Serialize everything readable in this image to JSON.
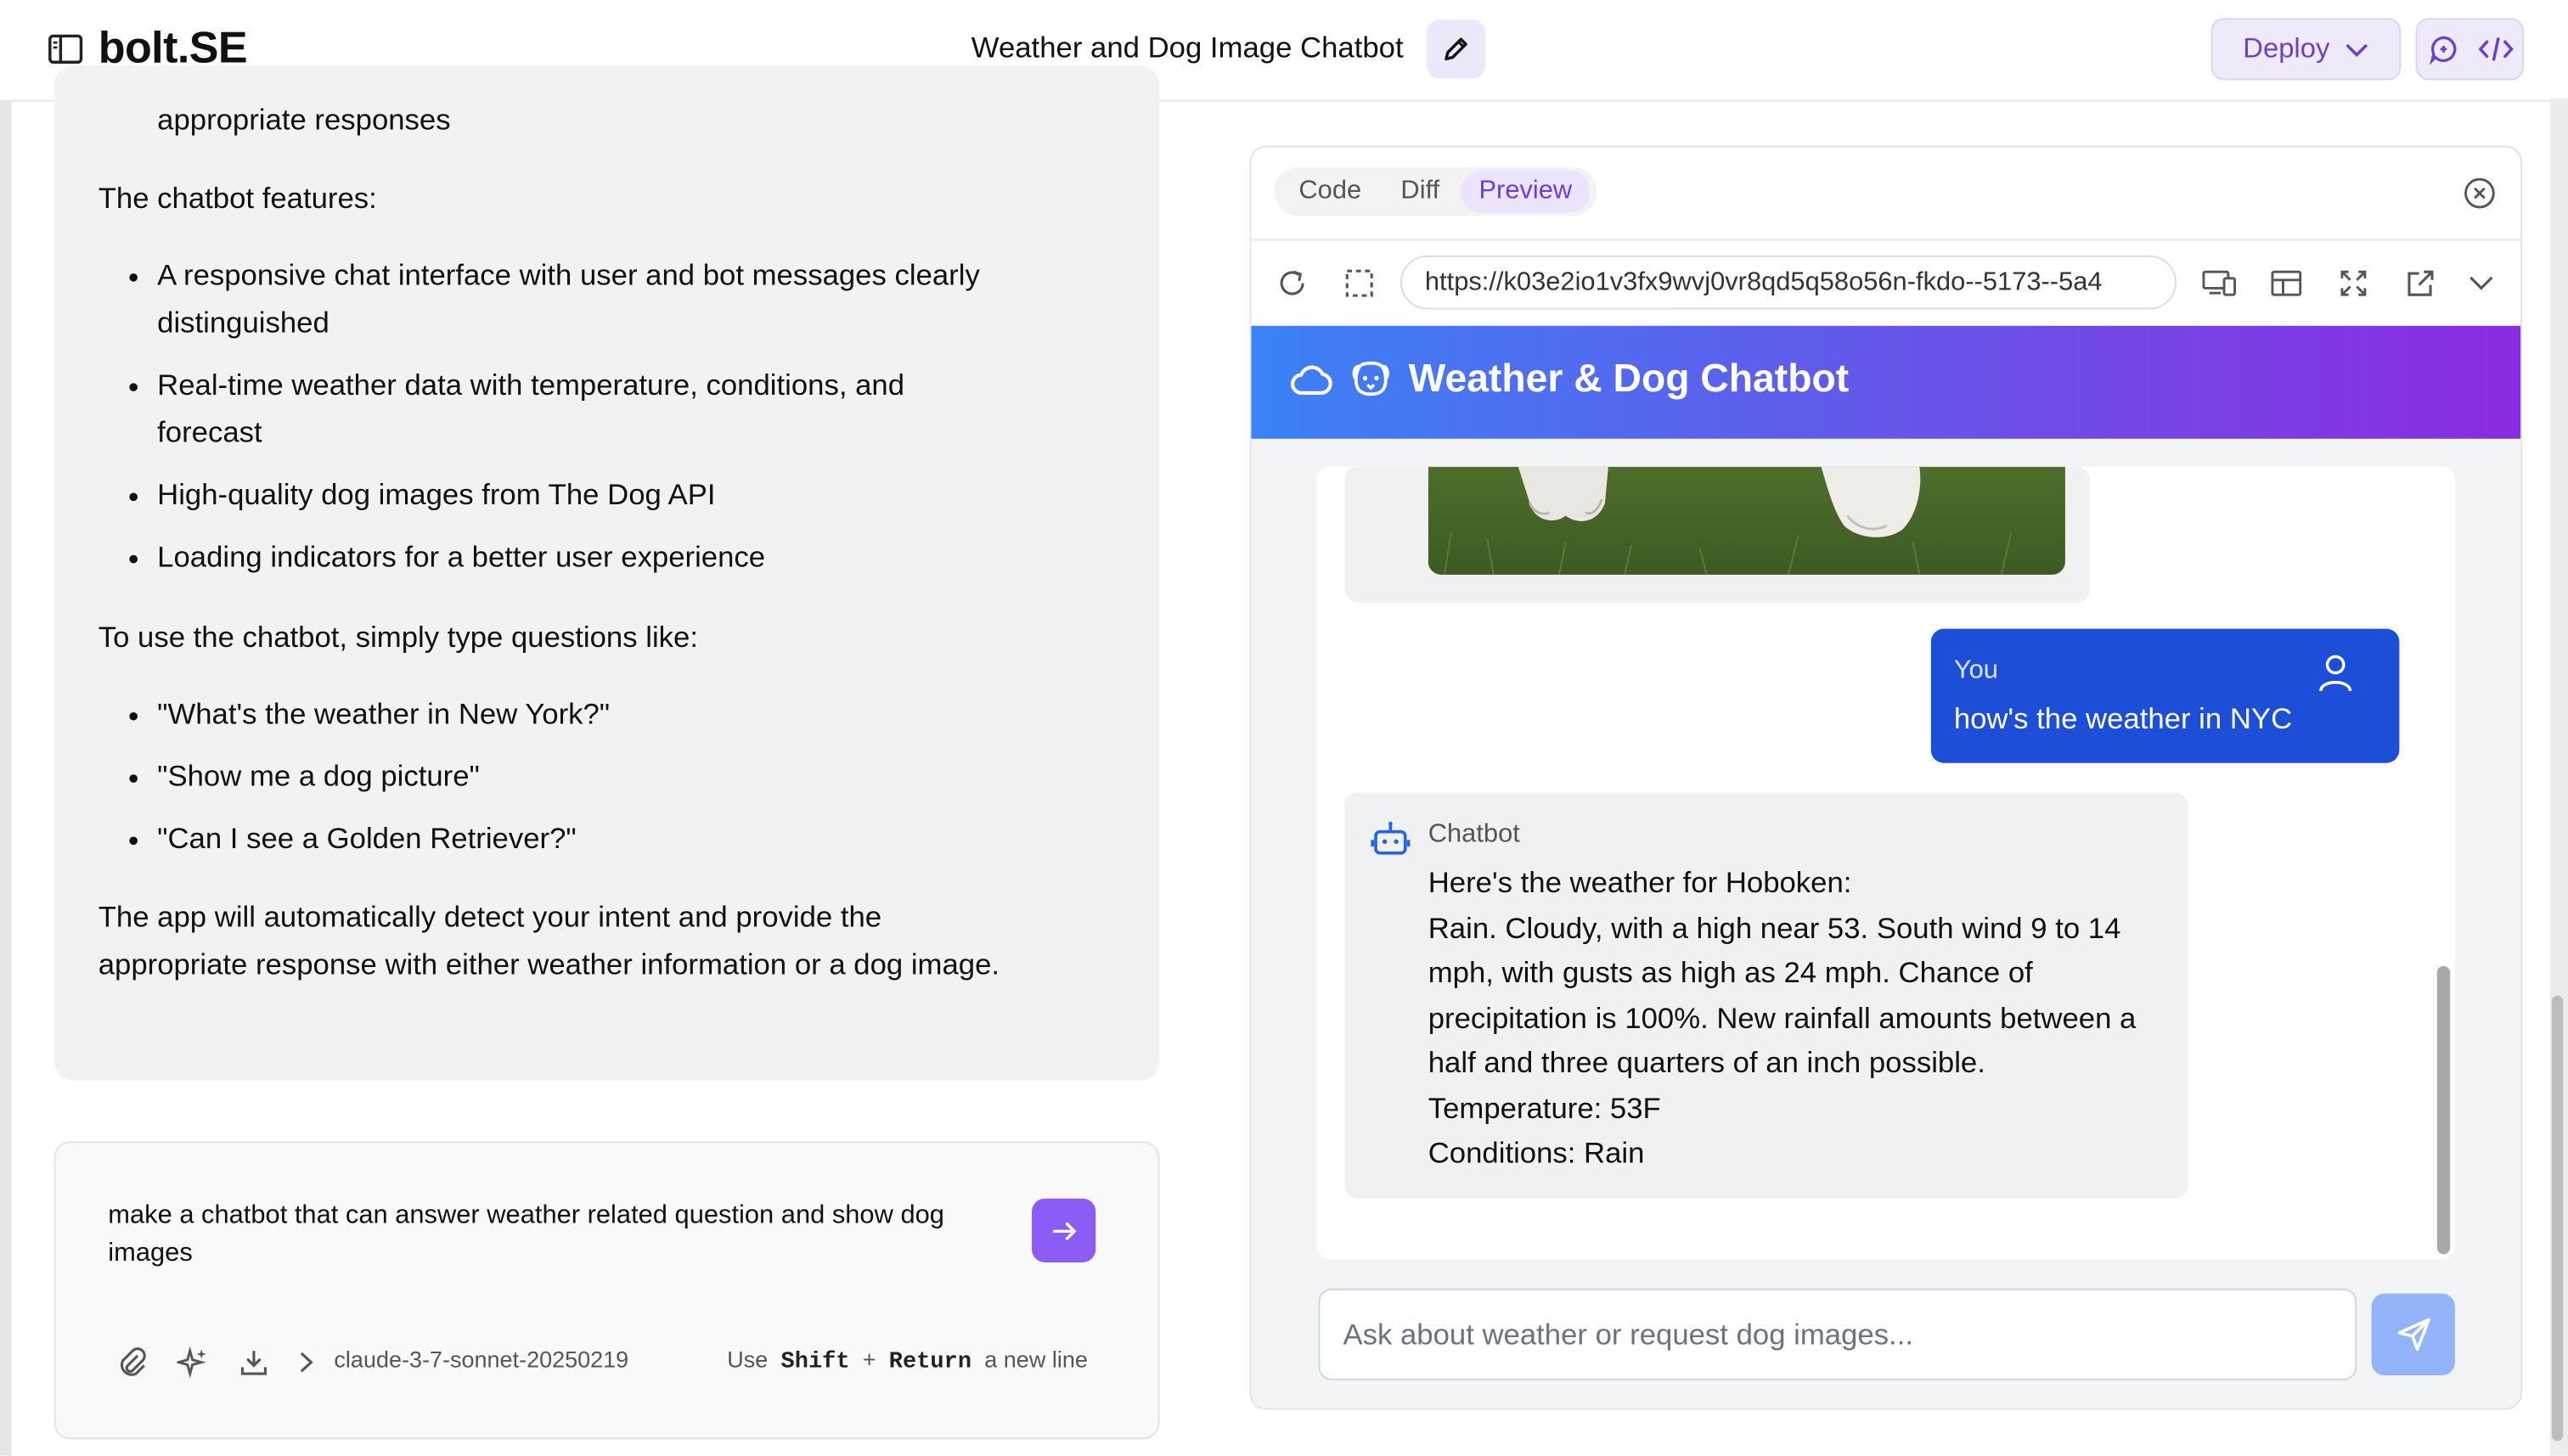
{
  "header": {
    "logo": "bolt.SE",
    "project_title": "Weather and Dog Image Chatbot",
    "deploy_label": "Deploy"
  },
  "chat": {
    "partial_line": "appropriate responses",
    "features_heading": "The chatbot features:",
    "features": [
      "A responsive chat interface with user and bot messages clearly distinguished",
      "Real-time weather data with temperature, conditions, and forecast",
      "High-quality dog images from The Dog API",
      "Loading indicators for a better user experience"
    ],
    "usage_heading": "To use the chatbot, simply type questions like:",
    "examples": [
      "\"What's the weather in New York?\"",
      "\"Show me a dog picture\"",
      "\"Can I see a Golden Retriever?\""
    ],
    "closing": "The app will automatically detect your intent and provide the appropriate response with either weather information or a dog image."
  },
  "prompt": {
    "text": "make a chatbot that can answer weather related question and show dog images",
    "model": "claude-3-7-sonnet-20250219",
    "hint_use": "Use",
    "hint_shift": "Shift",
    "hint_plus": "+",
    "hint_return": "Return",
    "hint_tail": "a new line"
  },
  "workbench": {
    "tabs": [
      "Code",
      "Diff",
      "Preview"
    ],
    "active_tab": "Preview",
    "url": "https://k03e2io1v3fx9wvj0vr8qd5q58o56n-fkdo--5173--5a4"
  },
  "preview": {
    "app_title": "Weather & Dog Chatbot",
    "user_sender": "You",
    "user_message": "how's the weather in NYC",
    "bot_sender": "Chatbot",
    "bot_lines": [
      "Here's the weather for Hoboken:",
      "Rain. Cloudy, with a high near 53. South wind 9 to 14 mph, with gusts as high as 24 mph. Chance of precipitation is 100%. New rainfall amounts between a half and three quarters of an inch possible.",
      "Temperature: 53F",
      "Conditions: Rain"
    ],
    "input_placeholder": "Ask about weather or request dog images..."
  },
  "colors": {
    "accent_purple": "#8b5cf6",
    "user_bubble": "#1d4ed8",
    "header_gradient_start": "#3b82f6",
    "header_gradient_end": "#8b2be2"
  },
  "icons": {
    "sidebar_toggle": "sidebar-icon",
    "edit": "pencil-icon",
    "chat_toggle": "chat-icon",
    "code_toggle": "code-icon",
    "attach": "paperclip-icon",
    "enhance": "sparkles-icon",
    "import": "download-icon",
    "model_expand": "chevron-right-icon",
    "reload": "refresh-icon",
    "select": "selection-icon",
    "devices": "devices-icon",
    "layout": "layout-icon",
    "fullscreen": "fullscreen-icon",
    "external": "external-link-icon",
    "more": "chevron-down-icon",
    "cloud": "cloud-icon",
    "dog": "dog-icon",
    "user": "user-icon",
    "bot": "bot-icon",
    "send": "send-icon",
    "close": "close-circle-icon"
  }
}
